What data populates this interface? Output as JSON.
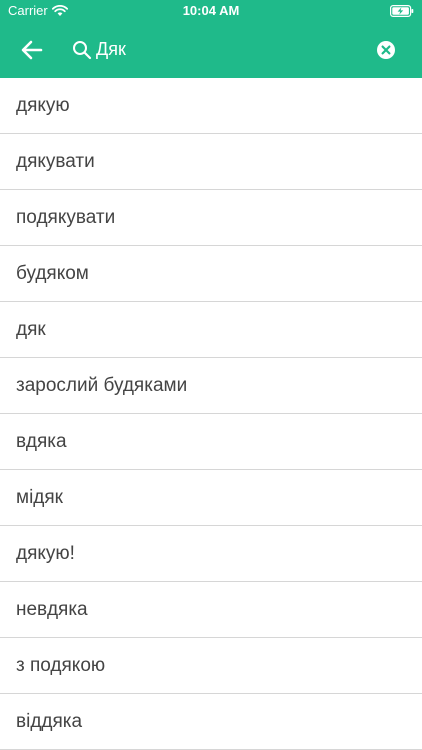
{
  "status_bar": {
    "carrier": "Carrier",
    "time": "10:04 AM",
    "wifi_icon": "wifi-icon",
    "battery_icon": "battery-charging-icon"
  },
  "header": {
    "background_color": "#1fba8a",
    "back_icon": "arrow-left-icon",
    "search_icon": "search-icon",
    "search_value": "Дяк",
    "clear_icon": "clear-circle-x-icon"
  },
  "results": [
    "дякую",
    "дякувати",
    "подякувати",
    "будяком",
    "дяк",
    "зарослий будяками",
    "вдяка",
    "мідяк",
    "дякую!",
    "невдяка",
    "з подякою",
    "віддяка"
  ]
}
